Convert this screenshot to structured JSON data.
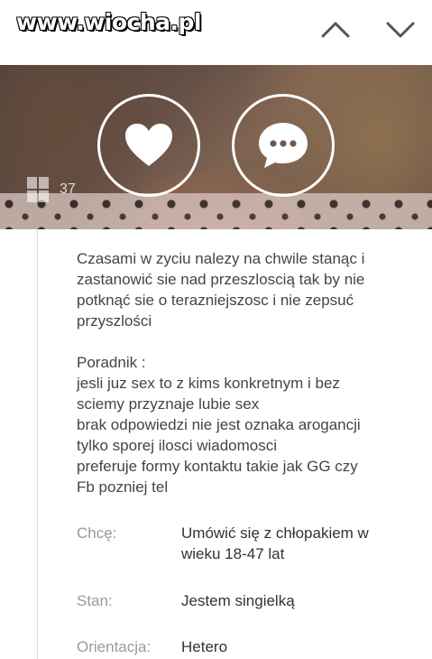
{
  "watermark": "www.wiocha.pl",
  "nav": {
    "up_icon": "chevron-up-icon",
    "down_icon": "chevron-down-icon"
  },
  "hero": {
    "photo_count": "37",
    "like_icon": "heart-icon",
    "message_icon": "chat-bubble-icon"
  },
  "description": {
    "intro_lines": [
      "Czasami w zyciu nalezy na chwile stanąc i",
      "zastanowić sie nad przeszloscią tak by nie",
      "potknąć sie o terazniejszosc i nie zepsuć",
      "przyszlości"
    ],
    "guide_lines": [
      "Poradnik :",
      "jesli juz sex to z kims konkretnym i bez",
      "sciemy przyznaje lubie sex",
      "brak odpowiedzi nie jest oznaka arogancji",
      "tylko sporej ilosci wiadomosci",
      "preferuje formy kontaktu takie jak GG czy",
      "Fb pozniej tel"
    ]
  },
  "details": [
    {
      "label": "Chcę:",
      "value": "Umówić się  z chłopakiem w wieku 18-47 lat"
    },
    {
      "label": "Stan:",
      "value": "Jestem singielką"
    },
    {
      "label": "Orientacja:",
      "value": "Hetero"
    }
  ],
  "colors": {
    "label": "#9a9a9a",
    "text": "#444444",
    "circle": "#ffffff"
  }
}
